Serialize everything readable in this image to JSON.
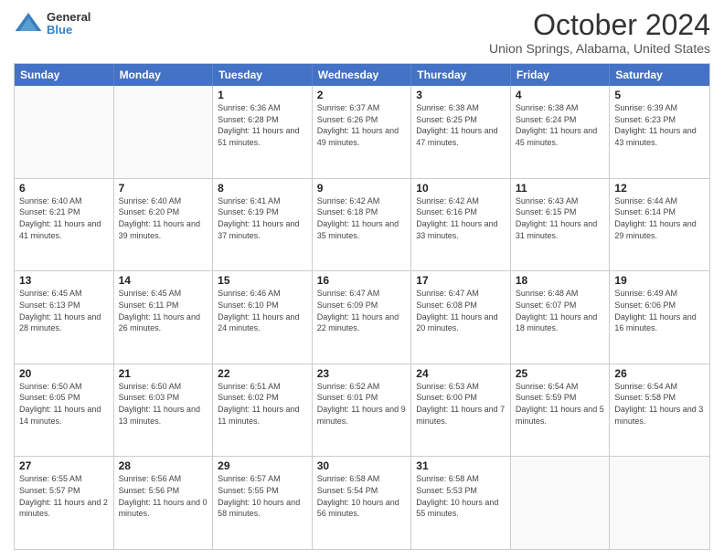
{
  "logo": {
    "general": "General",
    "blue": "Blue"
  },
  "header": {
    "month": "October 2024",
    "location": "Union Springs, Alabama, United States"
  },
  "weekdays": [
    "Sunday",
    "Monday",
    "Tuesday",
    "Wednesday",
    "Thursday",
    "Friday",
    "Saturday"
  ],
  "weeks": [
    [
      {
        "day": "",
        "info": ""
      },
      {
        "day": "",
        "info": ""
      },
      {
        "day": "1",
        "info": "Sunrise: 6:36 AM\nSunset: 6:28 PM\nDaylight: 11 hours and 51 minutes."
      },
      {
        "day": "2",
        "info": "Sunrise: 6:37 AM\nSunset: 6:26 PM\nDaylight: 11 hours and 49 minutes."
      },
      {
        "day": "3",
        "info": "Sunrise: 6:38 AM\nSunset: 6:25 PM\nDaylight: 11 hours and 47 minutes."
      },
      {
        "day": "4",
        "info": "Sunrise: 6:38 AM\nSunset: 6:24 PM\nDaylight: 11 hours and 45 minutes."
      },
      {
        "day": "5",
        "info": "Sunrise: 6:39 AM\nSunset: 6:23 PM\nDaylight: 11 hours and 43 minutes."
      }
    ],
    [
      {
        "day": "6",
        "info": "Sunrise: 6:40 AM\nSunset: 6:21 PM\nDaylight: 11 hours and 41 minutes."
      },
      {
        "day": "7",
        "info": "Sunrise: 6:40 AM\nSunset: 6:20 PM\nDaylight: 11 hours and 39 minutes."
      },
      {
        "day": "8",
        "info": "Sunrise: 6:41 AM\nSunset: 6:19 PM\nDaylight: 11 hours and 37 minutes."
      },
      {
        "day": "9",
        "info": "Sunrise: 6:42 AM\nSunset: 6:18 PM\nDaylight: 11 hours and 35 minutes."
      },
      {
        "day": "10",
        "info": "Sunrise: 6:42 AM\nSunset: 6:16 PM\nDaylight: 11 hours and 33 minutes."
      },
      {
        "day": "11",
        "info": "Sunrise: 6:43 AM\nSunset: 6:15 PM\nDaylight: 11 hours and 31 minutes."
      },
      {
        "day": "12",
        "info": "Sunrise: 6:44 AM\nSunset: 6:14 PM\nDaylight: 11 hours and 29 minutes."
      }
    ],
    [
      {
        "day": "13",
        "info": "Sunrise: 6:45 AM\nSunset: 6:13 PM\nDaylight: 11 hours and 28 minutes."
      },
      {
        "day": "14",
        "info": "Sunrise: 6:45 AM\nSunset: 6:11 PM\nDaylight: 11 hours and 26 minutes."
      },
      {
        "day": "15",
        "info": "Sunrise: 6:46 AM\nSunset: 6:10 PM\nDaylight: 11 hours and 24 minutes."
      },
      {
        "day": "16",
        "info": "Sunrise: 6:47 AM\nSunset: 6:09 PM\nDaylight: 11 hours and 22 minutes."
      },
      {
        "day": "17",
        "info": "Sunrise: 6:47 AM\nSunset: 6:08 PM\nDaylight: 11 hours and 20 minutes."
      },
      {
        "day": "18",
        "info": "Sunrise: 6:48 AM\nSunset: 6:07 PM\nDaylight: 11 hours and 18 minutes."
      },
      {
        "day": "19",
        "info": "Sunrise: 6:49 AM\nSunset: 6:06 PM\nDaylight: 11 hours and 16 minutes."
      }
    ],
    [
      {
        "day": "20",
        "info": "Sunrise: 6:50 AM\nSunset: 6:05 PM\nDaylight: 11 hours and 14 minutes."
      },
      {
        "day": "21",
        "info": "Sunrise: 6:50 AM\nSunset: 6:03 PM\nDaylight: 11 hours and 13 minutes."
      },
      {
        "day": "22",
        "info": "Sunrise: 6:51 AM\nSunset: 6:02 PM\nDaylight: 11 hours and 11 minutes."
      },
      {
        "day": "23",
        "info": "Sunrise: 6:52 AM\nSunset: 6:01 PM\nDaylight: 11 hours and 9 minutes."
      },
      {
        "day": "24",
        "info": "Sunrise: 6:53 AM\nSunset: 6:00 PM\nDaylight: 11 hours and 7 minutes."
      },
      {
        "day": "25",
        "info": "Sunrise: 6:54 AM\nSunset: 5:59 PM\nDaylight: 11 hours and 5 minutes."
      },
      {
        "day": "26",
        "info": "Sunrise: 6:54 AM\nSunset: 5:58 PM\nDaylight: 11 hours and 3 minutes."
      }
    ],
    [
      {
        "day": "27",
        "info": "Sunrise: 6:55 AM\nSunset: 5:57 PM\nDaylight: 11 hours and 2 minutes."
      },
      {
        "day": "28",
        "info": "Sunrise: 6:56 AM\nSunset: 5:56 PM\nDaylight: 11 hours and 0 minutes."
      },
      {
        "day": "29",
        "info": "Sunrise: 6:57 AM\nSunset: 5:55 PM\nDaylight: 10 hours and 58 minutes."
      },
      {
        "day": "30",
        "info": "Sunrise: 6:58 AM\nSunset: 5:54 PM\nDaylight: 10 hours and 56 minutes."
      },
      {
        "day": "31",
        "info": "Sunrise: 6:58 AM\nSunset: 5:53 PM\nDaylight: 10 hours and 55 minutes."
      },
      {
        "day": "",
        "info": ""
      },
      {
        "day": "",
        "info": ""
      }
    ]
  ]
}
